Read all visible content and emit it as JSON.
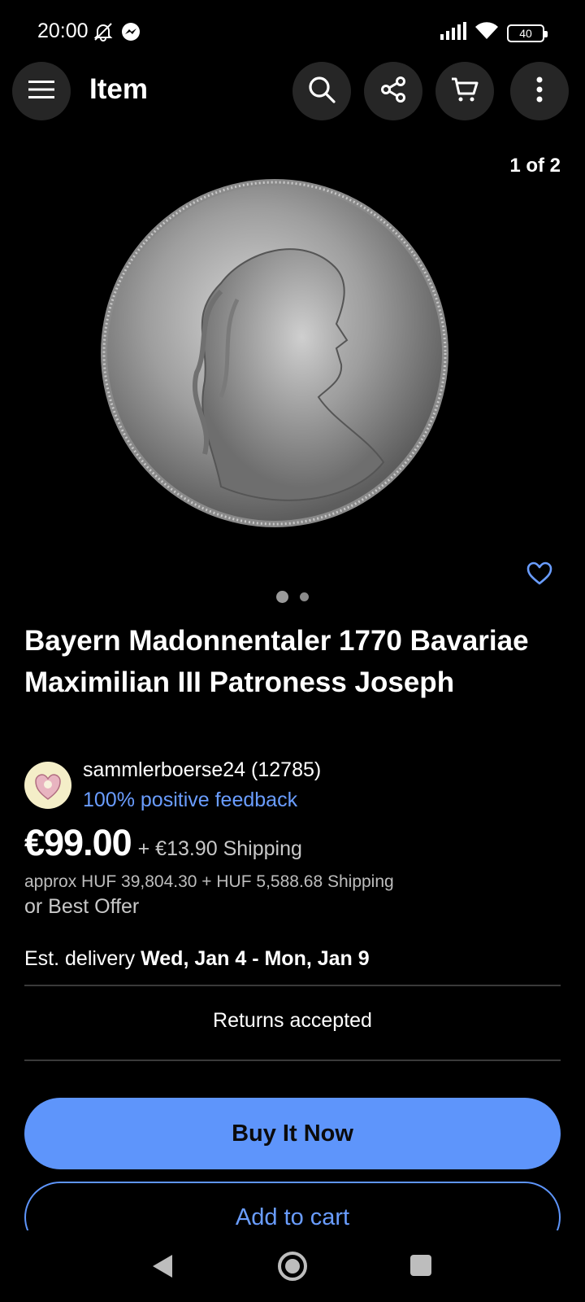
{
  "status_bar": {
    "time": "20:00",
    "battery": "40",
    "icons": [
      "mute-bell-icon",
      "messenger-icon",
      "signal-icon",
      "wifi-icon",
      "battery-icon"
    ]
  },
  "app_bar": {
    "title": "Item",
    "icons": [
      "menu-icon",
      "search-icon",
      "share-icon",
      "cart-icon",
      "more-vertical-icon"
    ]
  },
  "gallery": {
    "counter": "1 of 2",
    "image_description": "silver coin portrait",
    "current_index": 1,
    "total": 2
  },
  "item": {
    "title": "Bayern Madonnentaler 1770 Bavariae Maximilian III Patroness Joseph"
  },
  "seller": {
    "name": "sammlerboerse24 (12785)",
    "feedback": "100% positive feedback"
  },
  "pricing": {
    "price": "€99.00",
    "shipping": "+ €13.90 Shipping",
    "approx": "approx HUF 39,804.30  + HUF 5,588.68 Shipping",
    "best_offer": "or Best Offer"
  },
  "delivery": {
    "label": "Est. delivery",
    "dates": "Wed, Jan 4 - Mon, Jan 9"
  },
  "returns": "Returns accepted",
  "actions": {
    "buy_now": "Buy It Now",
    "add_to_cart": "Add to cart"
  },
  "colors": {
    "accent": "#5e95fb",
    "link": "#6a9dff",
    "background": "#000000"
  }
}
